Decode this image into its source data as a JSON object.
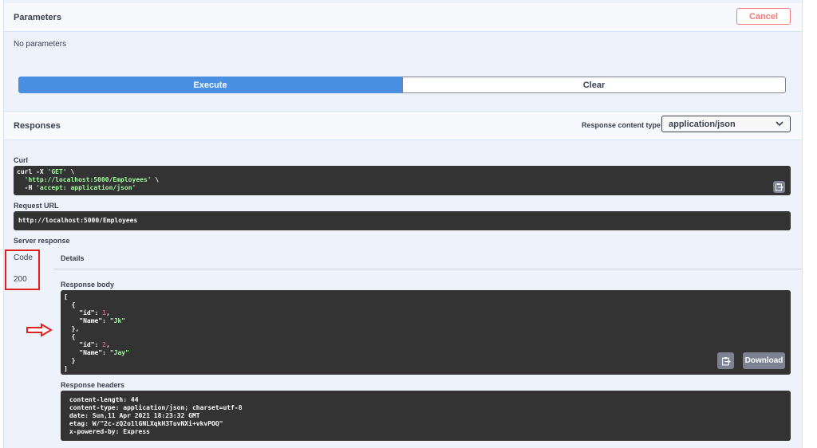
{
  "parameters": {
    "title": "Parameters",
    "cancel_label": "Cancel",
    "empty_text": "No parameters"
  },
  "actions": {
    "execute_label": "Execute",
    "clear_label": "Clear"
  },
  "responses": {
    "title": "Responses",
    "content_type_label": "Response content type",
    "content_type_value": "application/json"
  },
  "curl": {
    "label": "Curl",
    "line1_a": "curl -X ",
    "line1_b": "'GET'",
    "line1_c": " \\",
    "line2_indent": "  ",
    "line2_a": "'http://localhost:5000/Employees'",
    "line2_b": " \\",
    "line3_indent": "  -H ",
    "line3_a": "'accept: application/json'"
  },
  "request_url": {
    "label": "Request URL",
    "value": "http://localhost:5000/Employees"
  },
  "server_response": {
    "label": "Server response",
    "code_header": "Code",
    "details_header": "Details",
    "code_value": "200",
    "body_label": "Response body",
    "body": {
      "l1": "[",
      "l2": "  {",
      "l3_key": "    \"id\"",
      "l3_sep": ": ",
      "l3_val": "1",
      "l3_end": ",",
      "l4_key": "    \"Name\"",
      "l4_sep": ": ",
      "l4_val": "\"Jk\"",
      "l5": "  },",
      "l6": "  {",
      "l7_key": "    \"id\"",
      "l7_sep": ": ",
      "l7_val": "2",
      "l7_end": ",",
      "l8_key": "    \"Name\"",
      "l8_sep": ": ",
      "l8_val": "\"Jay\"",
      "l9": "  }",
      "l10": "]"
    },
    "download_label": "Download",
    "headers_label": "Response headers",
    "headers": [
      " content-length: 44 ",
      " content-type: application/json; charset=utf-8 ",
      " date: Sun,11 Apr 2021 18:23:32 GMT ",
      " etag: W/\"2c-zQ2o1lGNLXqkH3TuvNXi+vkvPOQ\" ",
      " x-powered-by: Express "
    ]
  },
  "colors": {
    "execute": "#4990e2",
    "cancel": "#f27b7b",
    "annotation_red": "#e02020",
    "code_bg": "#333333"
  },
  "icons": {
    "copy": "clipboard-icon",
    "arrow": "right-arrow-annotation-icon",
    "select": "chevron-down-icon"
  }
}
